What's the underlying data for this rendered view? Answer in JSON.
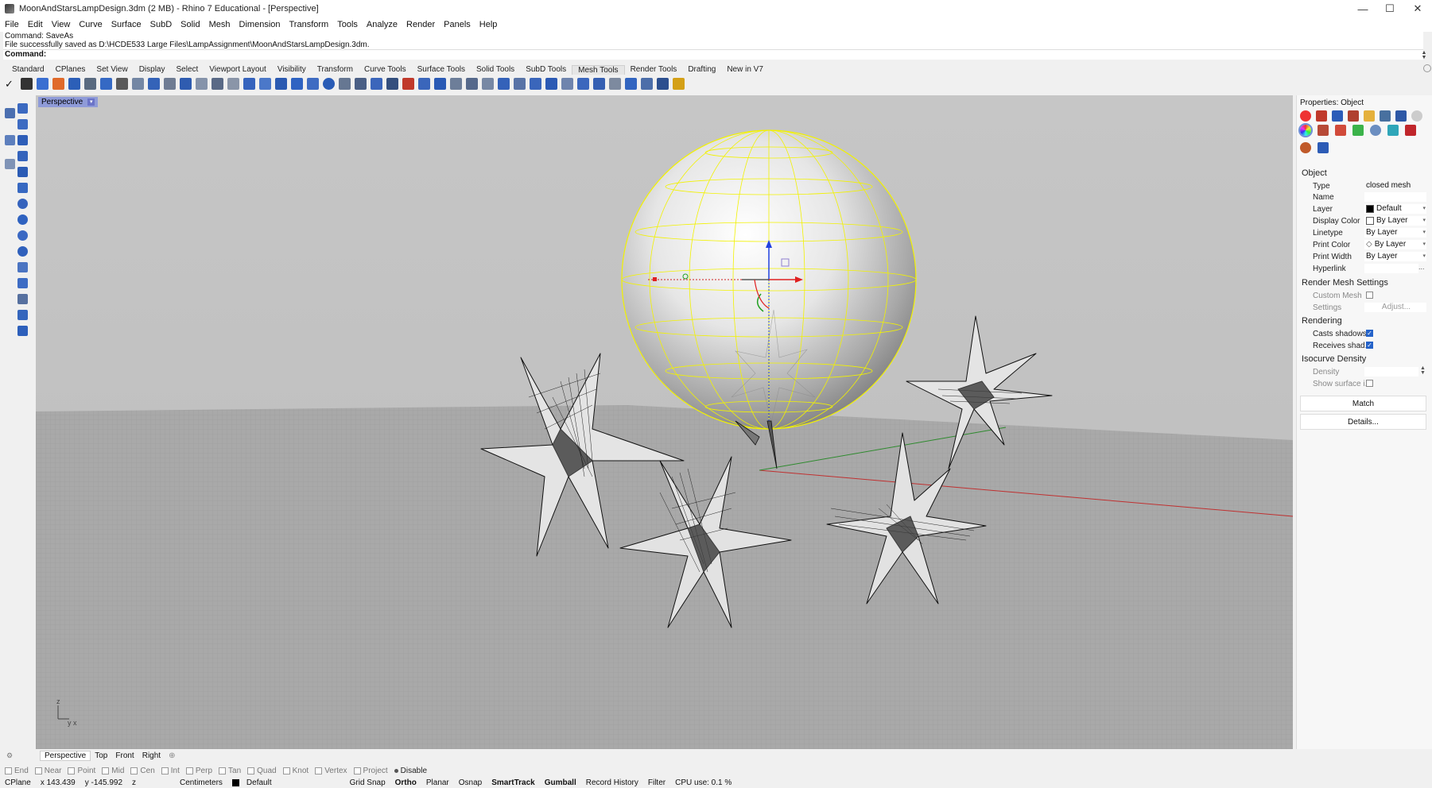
{
  "window": {
    "title": "MoonAndStarsLampDesign.3dm (2 MB) - Rhino 7 Educational - [Perspective]",
    "minimize": "—",
    "maximize": "☐",
    "close": "✕"
  },
  "menu": [
    "File",
    "Edit",
    "View",
    "Curve",
    "Surface",
    "SubD",
    "Solid",
    "Mesh",
    "Dimension",
    "Transform",
    "Tools",
    "Analyze",
    "Render",
    "Panels",
    "Help"
  ],
  "command_history": {
    "line1": "Command:  SaveAs",
    "line2": "File successfully saved as D:\\HCDE533 Large Files\\LampAssignment\\MoonAndStarsLampDesign.3dm.",
    "prompt": "Command:"
  },
  "toolbar_tabs": [
    "Standard",
    "CPlanes",
    "Set View",
    "Display",
    "Select",
    "Viewport Layout",
    "Visibility",
    "Transform",
    "Curve Tools",
    "Surface Tools",
    "Solid Tools",
    "SubD Tools",
    "Mesh Tools",
    "Render Tools",
    "Drafting",
    "New in V7"
  ],
  "active_tab": "Mesh Tools",
  "viewport": {
    "name": "Perspective",
    "caret": "▾",
    "axis_labels": {
      "z": "z",
      "yx": "y x"
    }
  },
  "viewport_tabs": [
    "Perspective",
    "Top",
    "Front",
    "Right"
  ],
  "viewport_tabs_add": "⊕",
  "osnaps": [
    "End",
    "Near",
    "Point",
    "Mid",
    "Cen",
    "Int",
    "Perp",
    "Tan",
    "Quad",
    "Knot",
    "Vertex",
    "Project"
  ],
  "osnap_disable": "Disable",
  "status": {
    "cplane": "CPlane",
    "x": "x 143.439",
    "y": "y -145.992",
    "z": "z",
    "units": "Centimeters",
    "layer": "Default",
    "grid_snap": "Grid Snap",
    "ortho": "Ortho",
    "planar": "Planar",
    "osnap": "Osnap",
    "smarttrack": "SmartTrack",
    "gumball": "Gumball",
    "record_history": "Record History",
    "filter": "Filter",
    "cpu": "CPU use: 0.1 %"
  },
  "properties": {
    "header": "Properties: Object",
    "section_object": "Object",
    "type_label": "Type",
    "type_value": "closed mesh",
    "name_label": "Name",
    "name_value": "",
    "layer_label": "Layer",
    "layer_value": "Default",
    "display_color_label": "Display Color",
    "display_color_value": "By Layer",
    "linetype_label": "Linetype",
    "linetype_value": "By Layer",
    "print_color_label": "Print Color",
    "print_color_value": "By Layer",
    "print_width_label": "Print Width",
    "print_width_value": "By Layer",
    "hyperlink_label": "Hyperlink",
    "hyperlink_btn": "...",
    "section_render_mesh": "Render Mesh Settings",
    "custom_mesh_label": "Custom Mesh",
    "settings_label": "Settings",
    "settings_btn": "Adjust...",
    "section_rendering": "Rendering",
    "casts_shadows_label": "Casts shadows",
    "receives_shadows_label": "Receives shad...",
    "section_isocurve": "Isocurve Density",
    "density_label": "Density",
    "show_surface_label": "Show surface i...",
    "match_btn": "Match",
    "details_btn": "Details...",
    "casts_shadows": true,
    "receives_shadows": true,
    "custom_mesh": false,
    "show_surface": false
  },
  "colors": {
    "selection": "#ffff00",
    "viewport_bg": "#c2c2c2",
    "ground": "#a9a9a9",
    "active_viewport": "#8f9bd8",
    "gumball_x": "#e02020",
    "gumball_y": "#20a020",
    "gumball_z": "#2040e0"
  }
}
